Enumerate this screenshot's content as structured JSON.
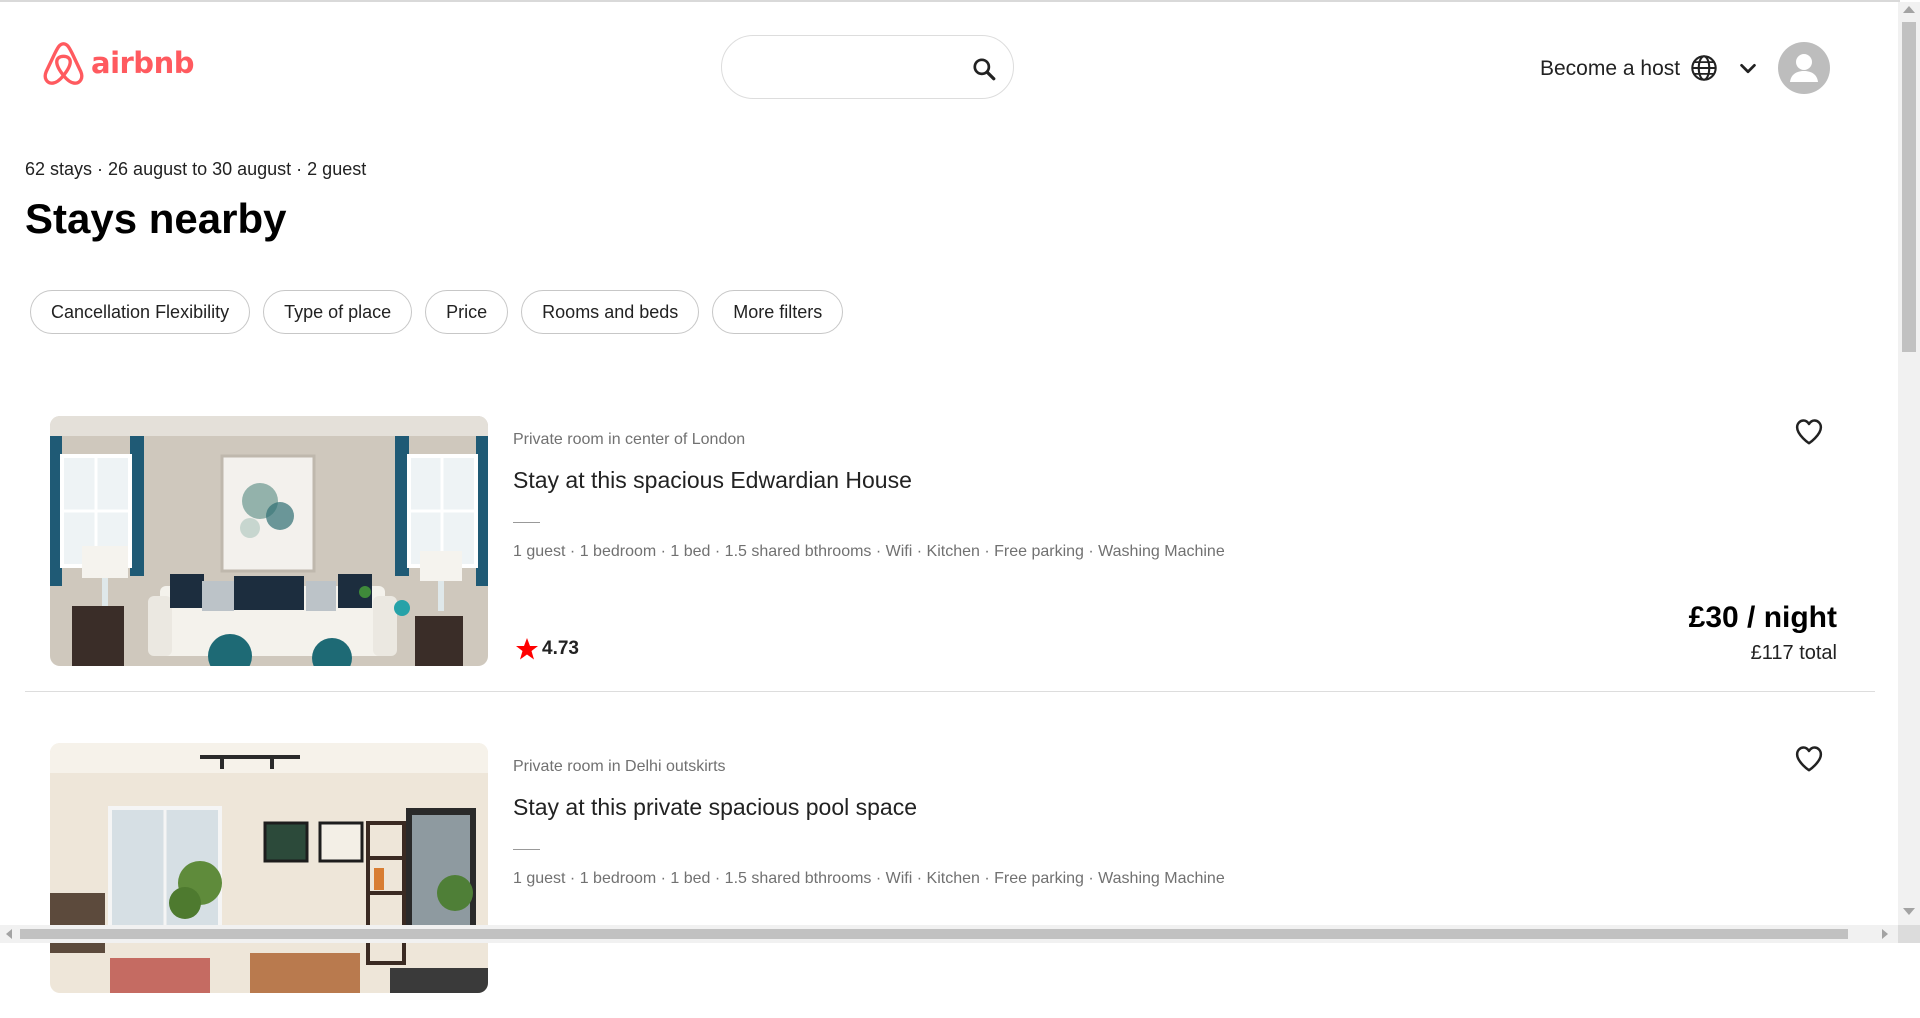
{
  "header": {
    "logo_text": "airbnb",
    "search_placeholder": "",
    "become_host": "Become a host",
    "icons": {
      "logo": "airbnb-logo",
      "search": "search-icon",
      "globe": "globe-icon",
      "chevron": "chevron-down-icon",
      "avatar": "user-avatar-icon"
    }
  },
  "summary": "62 stays · 26 august to 30 august · 2 guest",
  "page_title": "Stays nearby",
  "filters": [
    "Cancellation Flexibility",
    "Type of place",
    "Price",
    "Rooms and beds",
    "More filters"
  ],
  "listings": [
    {
      "type": "Private room in center of London",
      "title": "Stay at this spacious Edwardian House",
      "amenities": "1 guest · 1 bedroom · 1 bed · 1.5 shared bthrooms · Wifi · Kitchen · Free parking · Washing Machine",
      "rating": "4.73",
      "price": "£30 / night",
      "total": "£117 total"
    },
    {
      "type": "Private room in Delhi outskirts",
      "title": "Stay at this private spacious pool space",
      "amenities": "1 guest · 1 bedroom · 1 bed · 1.5 shared bthrooms · Wifi · Kitchen · Free parking · Washing Machine"
    }
  ],
  "colors": {
    "brand": "#ff5a5f",
    "star": "#ff0000",
    "muted_text": "#717171",
    "border": "#dddddd"
  }
}
